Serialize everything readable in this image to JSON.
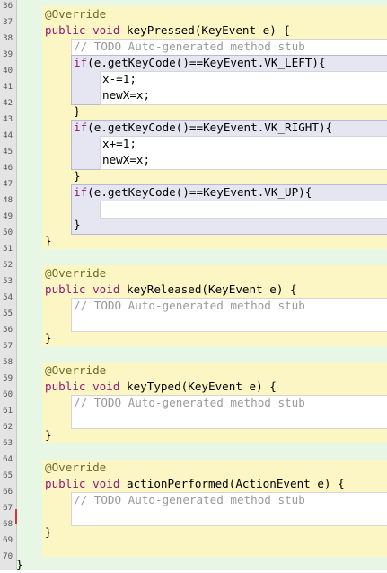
{
  "gutter": {
    "line_numbers": [
      "36",
      "37",
      "38",
      "39",
      "40",
      "41",
      "42",
      "43",
      "44",
      "45",
      "46",
      "47",
      "48",
      "49",
      "50",
      "51",
      "52",
      "53",
      "54",
      "55",
      "56",
      "57",
      "58",
      "59",
      "60",
      "61",
      "62",
      "63",
      "64",
      "65",
      "66",
      "67",
      "68",
      "69",
      "70"
    ]
  },
  "code": {
    "annotation": "@Override",
    "kw_public": "public",
    "kw_void": "void",
    "kw_if": "if",
    "todo_comment": "// TODO Auto-generated method stub",
    "method_keyPressed": " keyPressed(KeyEvent e) {",
    "if_left": "(e.getKeyCode()==KeyEvent.VK_LEFT){",
    "stmt_x_minus": "x-=1;",
    "stmt_newx": "newX=x;",
    "close_brace": "}",
    "if_right": "(e.getKeyCode()==KeyEvent.VK_RIGHT){",
    "stmt_x_plus": "x+=1;",
    "if_up": "(e.getKeyCode()==KeyEvent.VK_UP){",
    "method_keyReleased": " keyReleased(KeyEvent e) {",
    "method_keyTyped": " keyTyped(KeyEvent e) {",
    "method_actionPerformed": " actionPerformed(ActionEvent e) {",
    "class_close": "}"
  }
}
